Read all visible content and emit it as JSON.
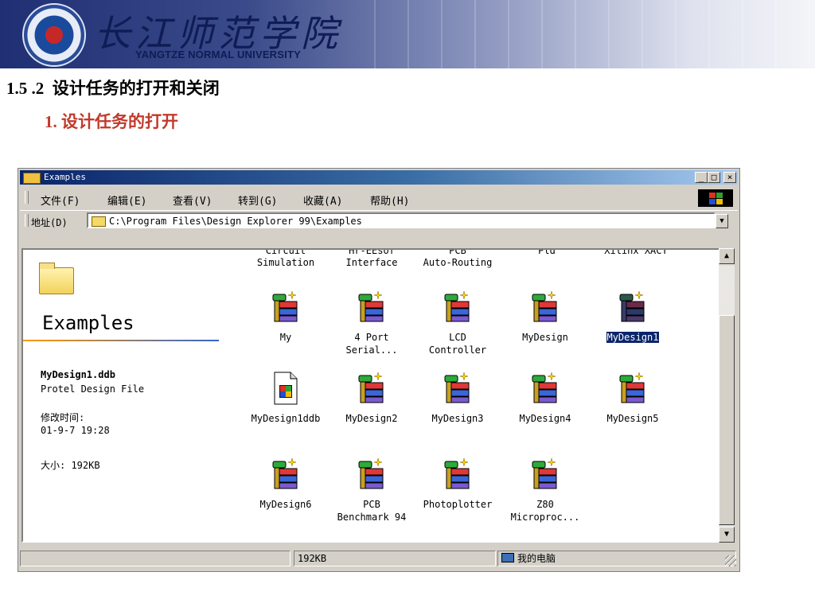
{
  "header": {
    "logo_cn": "长江师范学院",
    "logo_en": "YANGTZE NORMAL UNIVERSITY"
  },
  "slide": {
    "heading": "1.5 .2  设计任务的打开和关闭",
    "subheading": "1. 设计任务的打开"
  },
  "window": {
    "title": "Examples",
    "title_buttons": [
      "_",
      "□",
      "×"
    ],
    "menu": [
      "文件(F)",
      "编辑(E)",
      "查看(V)",
      "转到(G)",
      "收藏(A)",
      "帮助(H)"
    ],
    "address_label": "地址(D)",
    "address_value": "C:\\Program Files\\Design Explorer 99\\Examples",
    "left_panel": {
      "title": "Examples",
      "file_name": "MyDesign1.ddb",
      "file_type": "Protel Design File",
      "modified_label": "修改时间:",
      "modified_value": "01-9-7 19:28",
      "size_label": "大小: 192KB"
    },
    "cut_off_items": [
      {
        "line1": "Circuit",
        "line2": "Simulation"
      },
      {
        "line1": "Hr-EEsof",
        "line2": "Interface"
      },
      {
        "line1": "PCB",
        "line2": "Auto-Routing"
      },
      {
        "line1": "Pld",
        "line2": ""
      },
      {
        "line1": "Xilinx XACT",
        "line2": ""
      }
    ],
    "items": [
      {
        "label": "My",
        "icon": "ddb-icon",
        "selected": false
      },
      {
        "label": "4 Port\nSerial...",
        "icon": "ddb-icon",
        "selected": false
      },
      {
        "label": "LCD\nController",
        "icon": "ddb-icon",
        "selected": false
      },
      {
        "label": "MyDesign",
        "icon": "ddb-icon",
        "selected": false
      },
      {
        "label": "MyDesign1",
        "icon": "ddb-icon",
        "selected": true
      },
      {
        "label": "MyDesign1ddb",
        "icon": "doc-icon",
        "selected": false
      },
      {
        "label": "MyDesign2",
        "icon": "ddb-icon",
        "selected": false
      },
      {
        "label": "MyDesign3",
        "icon": "ddb-icon",
        "selected": false
      },
      {
        "label": "MyDesign4",
        "icon": "ddb-icon",
        "selected": false
      },
      {
        "label": "MyDesign5",
        "icon": "ddb-icon",
        "selected": false
      },
      {
        "label": "MyDesign6",
        "icon": "ddb-icon",
        "selected": false
      },
      {
        "label": "PCB\nBenchmark 94",
        "icon": "ddb-icon",
        "selected": false
      },
      {
        "label": "Photoplotter",
        "icon": "ddb-icon",
        "selected": false
      },
      {
        "label": "Z80\nMicroproc...",
        "icon": "ddb-icon",
        "selected": false
      }
    ],
    "status": {
      "size": "192KB",
      "location": "我的电脑"
    }
  },
  "colors": {
    "title_bar": "#0a246a",
    "heading_red": "#c0392b",
    "selection": "#0a246a"
  }
}
